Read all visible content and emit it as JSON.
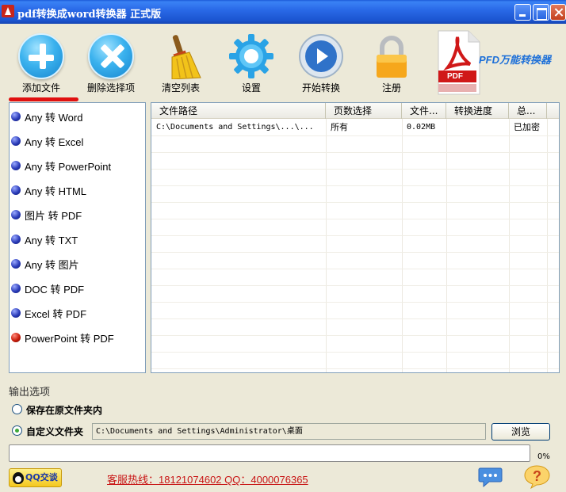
{
  "window": {
    "title": "pdf转换成word转换器 正式版"
  },
  "toolbar": {
    "add": "添加文件",
    "remove": "删除选择项",
    "clear": "清空列表",
    "settings": "设置",
    "start": "开始转换",
    "register": "注册",
    "brand": "PFD万能转换器",
    "pdf_label": "PDF"
  },
  "modes": [
    "Any 转 Word",
    "Any 转 Excel",
    "Any 转 PowerPoint",
    "Any 转 HTML",
    "图片 转 PDF",
    "Any 转 TXT",
    "Any 转 图片",
    "DOC 转 PDF",
    "Excel 转 PDF",
    "PowerPoint 转 PDF"
  ],
  "selected_mode_index": 9,
  "table": {
    "headers": [
      "文件路径",
      "页数选择",
      "文件...",
      "转换进度",
      "总..."
    ],
    "rows": [
      [
        "C:\\Documents and Settings\\...\\...",
        "所有",
        "0.02MB",
        "",
        "已加密"
      ]
    ]
  },
  "output": {
    "title": "输出选项",
    "option_original": "保存在原文件夹内",
    "option_custom": "自定义文件夹",
    "custom_selected": true,
    "path": "C:\\Documents and Settings\\Administrator\\桌面",
    "browse": "浏览"
  },
  "progress": {
    "percent_label": "0%",
    "value": 0
  },
  "footer": {
    "qq": "QQ交谈",
    "hotline": "客服热线：18121074602 QQ：4000076365"
  },
  "colors": {
    "titlebar": "#2a6ae8",
    "accent_blue": "#1685cf",
    "hotline_red": "#c81414",
    "selected_mode": "#c81b0a"
  }
}
